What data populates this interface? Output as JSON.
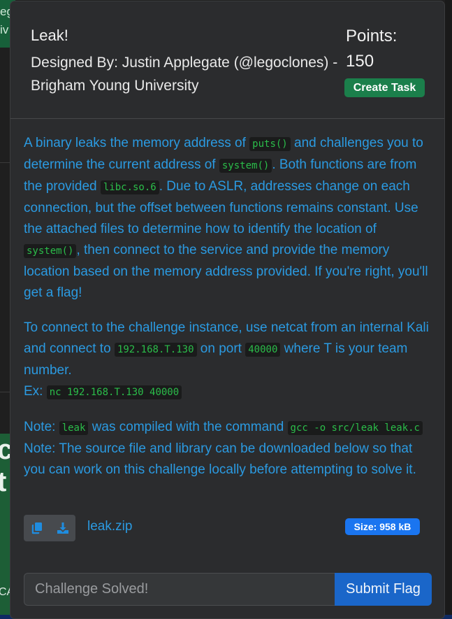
{
  "background": {
    "top_left_text": [
      "eg",
      "iv"
    ],
    "left_big_text": [
      "ck",
      "t"
    ],
    "left_small_text": "CA"
  },
  "modal": {
    "title": "Leak!",
    "designer": "Designed By: Justin Applegate (@legoclones) - Brigham Young University",
    "points_label": "Points:",
    "points_value": "150",
    "create_task_label": "Create Task",
    "description": {
      "p1": {
        "t1": "A binary leaks the memory address of ",
        "c1": "puts()",
        "t2": " and challenges you to determine the current address of ",
        "c2": "system()",
        "t3": ". Both functions are from the provided ",
        "c3": "libc.so.6",
        "t4": ". Due to ASLR, addresses change on each connection, but the offset between functions remains constant. Use the attached files to determine how to identify the location of ",
        "c4": "system()",
        "t5": ", then connect to the service and provide the memory location based on the memory address provided. If you're right, you'll get a flag!"
      },
      "p2": {
        "t1": "To connect to the challenge instance, use netcat from an internal Kali and connect to ",
        "c1": "192.168.T.130",
        "t2": " on port ",
        "c2": "40000",
        "t3": " where T is your team number.",
        "t4": "Ex: ",
        "c3": "nc 192.168.T.130 40000"
      },
      "p3": {
        "t1": "Note: ",
        "c1": "leak",
        "t2": " was compiled with the command ",
        "c2": "gcc -o src/leak leak.c",
        "t3": " Note: The source file and library can be downloaded below so that you can work on this challenge locally before attempting to solve it."
      }
    },
    "file": {
      "name": "leak.zip",
      "size_badge": "Size: 958 kB",
      "copy_icon": "copy-icon",
      "download_icon": "download-icon"
    },
    "flag_form": {
      "placeholder": "Challenge Solved!",
      "submit_label": "Submit Flag"
    }
  },
  "colors": {
    "accent_text": "#2b9ae1",
    "code_text": "#2bbd4a",
    "create_task_bg": "#1b7f4b",
    "size_badge_bg": "#1a75f0",
    "submit_bg": "#1a66c9"
  }
}
